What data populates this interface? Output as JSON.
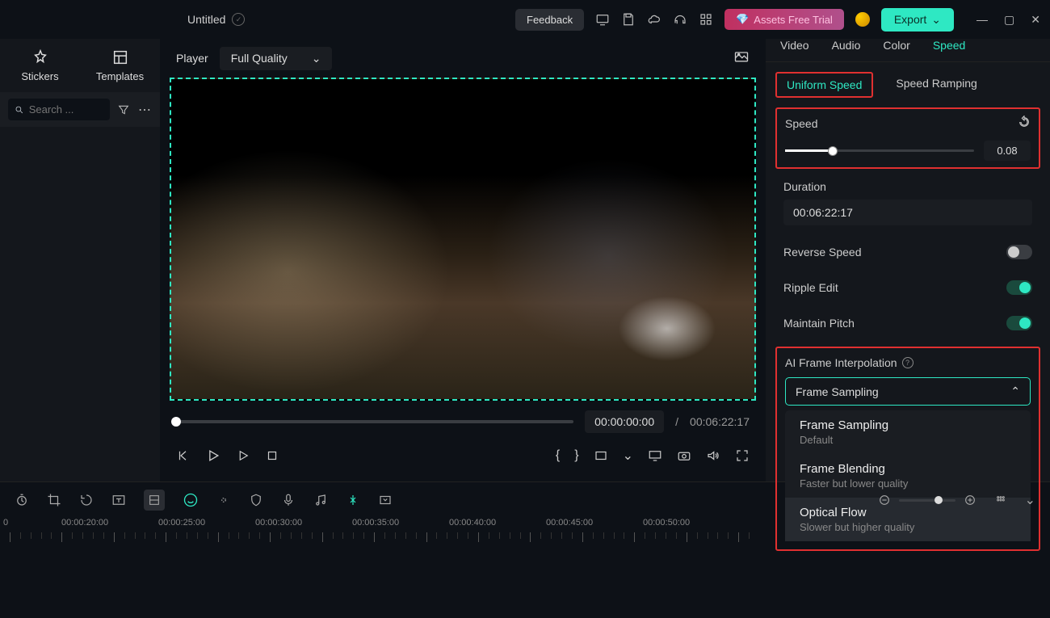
{
  "topbar": {
    "title": "Untitled",
    "feedback": "Feedback",
    "assets_trial": "Assets Free Trial",
    "export": "Export"
  },
  "sidebar": {
    "tabs": [
      "Stickers",
      "Templates"
    ],
    "search_placeholder": "Search ..."
  },
  "player": {
    "label": "Player",
    "quality": "Full Quality",
    "time_current": "00:00:00:00",
    "time_sep": "/",
    "time_total": "00:06:22:17"
  },
  "right": {
    "tabs": [
      "Video",
      "Audio",
      "Color",
      "Speed"
    ],
    "active_tab": 3,
    "subtabs": [
      "Uniform Speed",
      "Speed Ramping"
    ],
    "speed": {
      "label": "Speed",
      "value": "0.08"
    },
    "duration": {
      "label": "Duration",
      "value": "00:06:22:17"
    },
    "toggles": {
      "reverse": "Reverse Speed",
      "ripple": "Ripple Edit",
      "pitch": "Maintain Pitch"
    },
    "ai": {
      "label": "AI Frame Interpolation",
      "selected": "Frame Sampling",
      "options": [
        {
          "title": "Frame Sampling",
          "sub": "Default"
        },
        {
          "title": "Frame Blending",
          "sub": "Faster but lower quality"
        },
        {
          "title": "Optical Flow",
          "sub": "Slower but higher quality"
        }
      ]
    }
  },
  "timeline": {
    "marks": [
      "0",
      "00:00:20:00",
      "00:00:25:00",
      "00:00:30:00",
      "00:00:35:00",
      "00:00:40:00",
      "00:00:45:00",
      "00:00:50:00"
    ]
  }
}
